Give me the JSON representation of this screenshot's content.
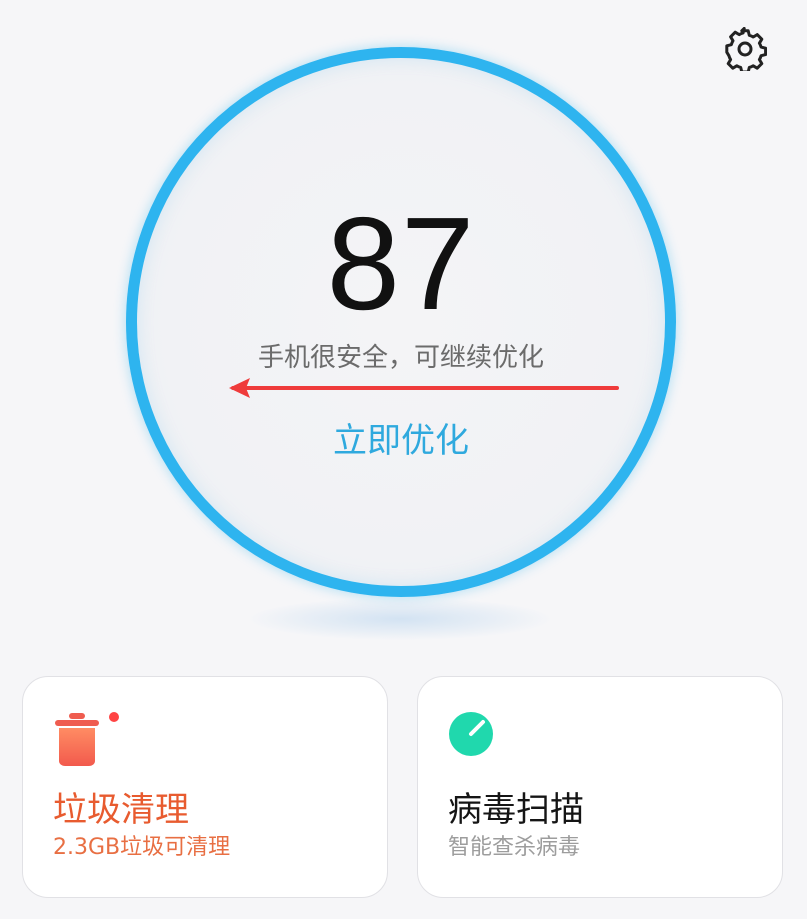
{
  "header": {
    "settings_icon": "gear-icon"
  },
  "gauge": {
    "score": "87",
    "status_text": "手机很安全，可继续优化",
    "action_label": "立即优化",
    "ring_color": "#2eb4ef",
    "action_color": "#2fa9de"
  },
  "cards": {
    "junk_clean": {
      "title": "垃圾清理",
      "subtitle": "2.3GB垃圾可清理",
      "icon": "trash-bin-icon",
      "badge_color": "#ff4343",
      "accent": "#e85b2f"
    },
    "virus_scan": {
      "title": "病毒扫描",
      "subtitle": "智能查杀病毒",
      "icon": "scan-dial-icon",
      "accent": "#20d8ad"
    }
  }
}
